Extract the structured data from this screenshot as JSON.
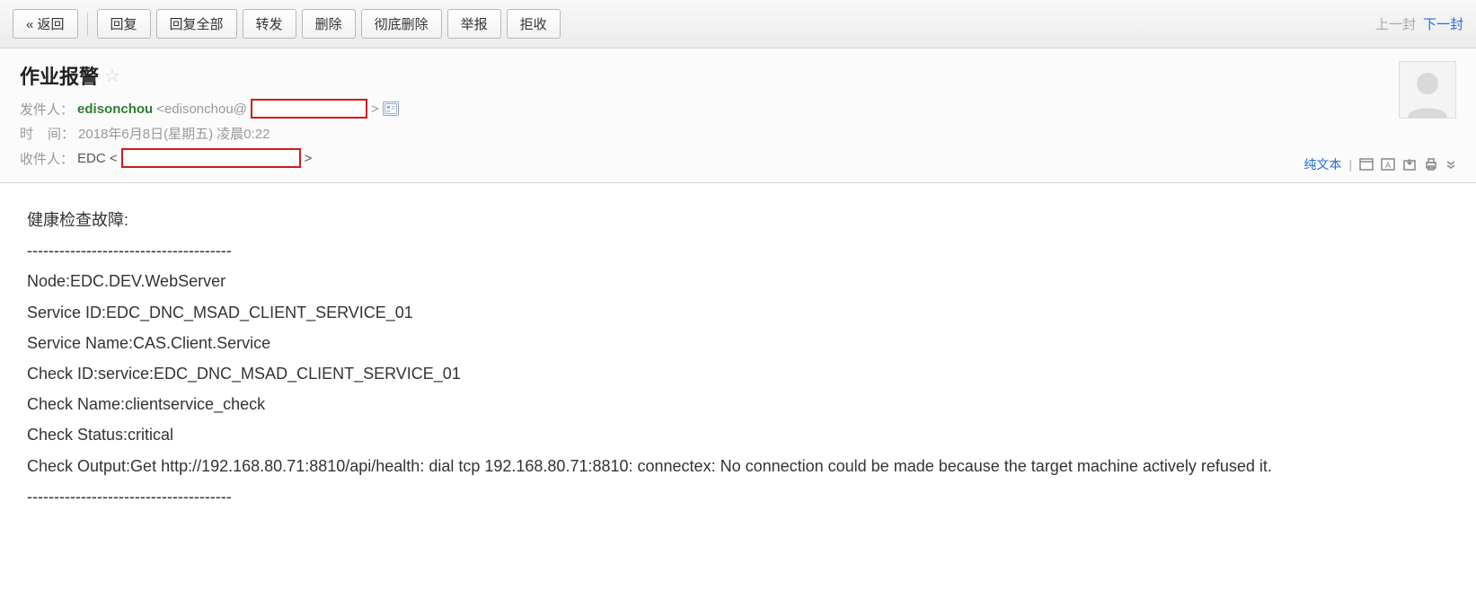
{
  "toolbar": {
    "back": "« 返回",
    "reply": "回复",
    "reply_all": "回复全部",
    "forward": "转发",
    "delete": "删除",
    "delete_perm": "彻底删除",
    "report": "举报",
    "reject": "拒收",
    "prev": "上一封",
    "next": "下一封"
  },
  "header": {
    "subject": "作业报警",
    "from_label": "发件人：",
    "sender_name": "edisonchou",
    "sender_prefix": "<edisonchou@",
    "sender_suffix": ">",
    "time_label_a": "时",
    "time_label_b": "间：",
    "time_value": "2018年6月8日(星期五) 凌晨0:22",
    "to_label": "收件人：",
    "to_name": "EDC <",
    "to_suffix": ">",
    "plain_text": "纯文本"
  },
  "body": {
    "l1": "健康检查故障:",
    "sep": "--------------------------------------",
    "l2": "Node:EDC.DEV.WebServer",
    "l3": "Service ID:EDC_DNC_MSAD_CLIENT_SERVICE_01",
    "l4": "Service Name:CAS.Client.Service",
    "l5": "Check ID:service:EDC_DNC_MSAD_CLIENT_SERVICE_01",
    "l6": "Check Name:clientservice_check",
    "l7": "Check Status:critical",
    "l8": "Check Output:Get http://192.168.80.71:8810/api/health: dial tcp 192.168.80.71:8810: connectex: No connection could be made because the target machine actively refused it."
  }
}
